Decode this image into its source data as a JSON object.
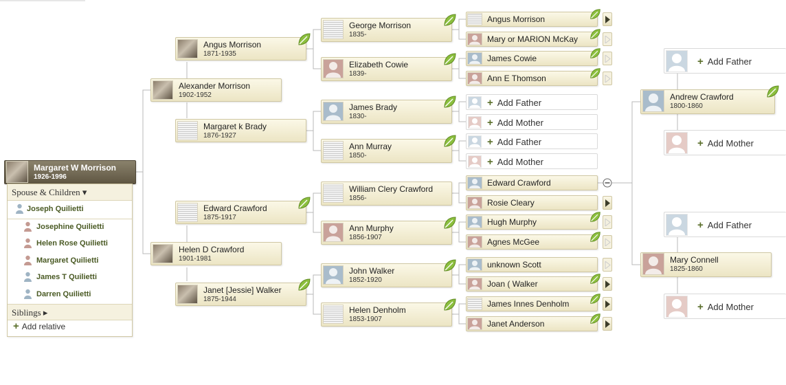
{
  "focus": {
    "name": "Margaret W Morrison",
    "life": "1926-1996"
  },
  "panel": {
    "spouse_header": "Spouse & Children ▾",
    "spouse": "Joseph Quilietti",
    "children": [
      "Josephine Quilietti",
      "Helen Rose Quilietti",
      "Margaret Quilietti",
      "James T Quilietti",
      "Darren Quilietti"
    ],
    "siblings_header": "Siblings ▸",
    "add_relative": "Add relative"
  },
  "gen1": {
    "father": {
      "name": "Alexander Morrison",
      "life": "1902-1952"
    },
    "mother": {
      "name": "Helen D Crawford",
      "life": "1901-1981"
    }
  },
  "gen2": {
    "ff": {
      "name": "Angus Morrison",
      "life": "1871-1935"
    },
    "fm": {
      "name": "Margaret k Brady",
      "life": "1876-1927"
    },
    "mf": {
      "name": "Edward Crawford",
      "life": "1875-1917"
    },
    "mm": {
      "name": "Janet [Jessie] Walker",
      "life": "1875-1944"
    }
  },
  "gen3": {
    "fff": {
      "name": "George Morrison",
      "life": "1835-"
    },
    "ffm": {
      "name": "Elizabeth Cowie",
      "life": "1839-"
    },
    "fmf": {
      "name": "James Brady",
      "life": "1830-"
    },
    "fmm": {
      "name": "Ann Murray",
      "life": "1850-"
    },
    "mff": {
      "name": "William Clery Crawford",
      "life": "1856-"
    },
    "mfm": {
      "name": "Ann Murphy",
      "life": "1856-1907"
    },
    "mmf": {
      "name": "John Walker",
      "life": "1852-1920"
    },
    "mmm": {
      "name": "Helen Denholm",
      "life": "1853-1907"
    }
  },
  "gen4": {
    "a": "Angus Morrison",
    "b": "Mary or MARION McKay",
    "c": "James Cowie",
    "d": "Ann E Thomson",
    "e": "Edward Crawford",
    "f": "Rosie Cleary",
    "g": "Hugh Murphy",
    "h": "Agnes McGee",
    "i": "unknown Scott",
    "j": "Joan ( Walker",
    "k": "James Innes Denholm",
    "l": "Janet Anderson"
  },
  "add": {
    "father": "Add Father",
    "mother": "Add Mother",
    "plus": "+"
  },
  "ext": {
    "father": {
      "name": "Andrew Crawford",
      "life": "1800-1860"
    },
    "mother": {
      "name": "Mary Connell",
      "life": "1825-1860"
    }
  },
  "colors": {
    "hint_leaf": "#8cbf3f",
    "card_bg": "#f3efd9",
    "focus_bg": "#6b634f",
    "plus": "#5a6e2a"
  }
}
